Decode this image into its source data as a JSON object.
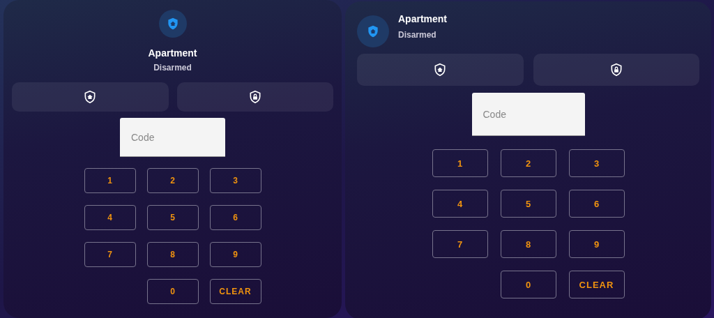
{
  "cards": [
    {
      "kind": "centered",
      "title": "Apartment",
      "state": "Disarmed",
      "actions": [
        {
          "kind": "arm_home"
        },
        {
          "kind": "arm_away"
        }
      ],
      "code_field": {
        "placeholder": "Code"
      },
      "keys": [
        {
          "label": "1",
          "kind": "digit"
        },
        {
          "label": "2",
          "kind": "digit"
        },
        {
          "label": "3",
          "kind": "digit"
        },
        {
          "label": "4",
          "kind": "digit"
        },
        {
          "label": "5",
          "kind": "digit"
        },
        {
          "label": "6",
          "kind": "digit"
        },
        {
          "label": "7",
          "kind": "digit"
        },
        {
          "label": "8",
          "kind": "digit"
        },
        {
          "label": "9",
          "kind": "digit"
        },
        {
          "label": "0",
          "kind": "digit"
        },
        {
          "label": "CLEAR",
          "kind": "clear"
        }
      ]
    },
    {
      "kind": "row",
      "title": "Apartment",
      "state": "Disarmed",
      "actions": [
        {
          "kind": "arm_home"
        },
        {
          "kind": "arm_away"
        }
      ],
      "code_field": {
        "placeholder": "Code"
      },
      "keys": [
        {
          "label": "1",
          "kind": "digit"
        },
        {
          "label": "2",
          "kind": "digit"
        },
        {
          "label": "3",
          "kind": "digit"
        },
        {
          "label": "4",
          "kind": "digit"
        },
        {
          "label": "5",
          "kind": "digit"
        },
        {
          "label": "6",
          "kind": "digit"
        },
        {
          "label": "7",
          "kind": "digit"
        },
        {
          "label": "8",
          "kind": "digit"
        },
        {
          "label": "9",
          "kind": "digit"
        },
        {
          "label": "0",
          "kind": "digit"
        },
        {
          "label": "CLEAR",
          "kind": "clear"
        }
      ]
    }
  ]
}
